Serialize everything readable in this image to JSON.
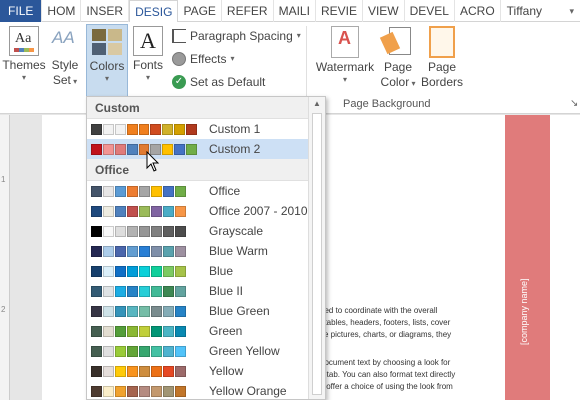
{
  "tabs": [
    {
      "label": "FILE",
      "active": false
    },
    {
      "label": "HOM",
      "active": false
    },
    {
      "label": "INSER",
      "active": false
    },
    {
      "label": "DESIG",
      "active": true
    },
    {
      "label": "PAGE",
      "active": false
    },
    {
      "label": "REFER",
      "active": false
    },
    {
      "label": "MAILI",
      "active": false
    },
    {
      "label": "REVIE",
      "active": false
    },
    {
      "label": "VIEW",
      "active": false
    },
    {
      "label": "DEVEL",
      "active": false
    },
    {
      "label": "ACRO",
      "active": false
    }
  ],
  "user_name": "Tiffany Gr...",
  "ribbon": {
    "themes": {
      "label": "Themes",
      "icon": "themes-icon"
    },
    "style_set": {
      "label1": "Style",
      "label2": "Set"
    },
    "colors": {
      "label": "Colors"
    },
    "fonts": {
      "label": "Fonts",
      "icon_glyph": "A"
    },
    "paragraph_spacing": "Paragraph Spacing",
    "effects": "Effects",
    "set_as_default": "Set as Default",
    "watermark": "Watermark",
    "page_color": {
      "label1": "Page",
      "label2": "Color"
    },
    "page_borders": {
      "label1": "Page",
      "label2": "Borders"
    },
    "group_page_background": "Page Background"
  },
  "dropdown": {
    "custom_header": "Custom",
    "office_header": "Office",
    "custom_items": [
      {
        "name": "Custom 1",
        "colors": [
          "#404040",
          "#f2f2f2",
          "#f2f2f2",
          "#f07f1e",
          "#f07f1e",
          "#d04c1f",
          "#d0b12a",
          "#d4a000",
          "#b03a1e"
        ],
        "hover": false
      },
      {
        "name": "Custom 2",
        "colors": [
          "#c0121c",
          "#f29494",
          "#e07b7b",
          "#4f81bd",
          "#e07b33",
          "#a5a5a5",
          "#ffc000",
          "#4472c4",
          "#70ad47"
        ],
        "hover": true
      }
    ],
    "office_items": [
      {
        "name": "Office",
        "colors": [
          "#44546a",
          "#e7e6e6",
          "#5b9bd5",
          "#ed7d31",
          "#a5a5a5",
          "#ffc000",
          "#4472c4",
          "#70ad47"
        ]
      },
      {
        "name": "Office 2007 - 2010",
        "colors": [
          "#1f497d",
          "#eeece1",
          "#4f81bd",
          "#c0504d",
          "#9bbb59",
          "#8064a2",
          "#4bacc6",
          "#f79646"
        ]
      },
      {
        "name": "Grayscale",
        "colors": [
          "#000000",
          "#f8f8f8",
          "#dddddd",
          "#b2b2b2",
          "#969696",
          "#808080",
          "#5f5f5f",
          "#4d4d4d"
        ]
      },
      {
        "name": "Blue Warm",
        "colors": [
          "#242852",
          "#acccea",
          "#4a66ac",
          "#629dd1",
          "#297fd5",
          "#7f8fa9",
          "#5aa2ae",
          "#9d90a0"
        ]
      },
      {
        "name": "Blue",
        "colors": [
          "#17406d",
          "#dbeff9",
          "#0f6fc6",
          "#009dd9",
          "#0bd0d9",
          "#10cf9b",
          "#7cca62",
          "#a5c249"
        ]
      },
      {
        "name": "Blue II",
        "colors": [
          "#335b74",
          "#dfe3e5",
          "#1cade4",
          "#2683c6",
          "#27ced7",
          "#42ba97",
          "#3e8853",
          "#62a39f"
        ]
      },
      {
        "name": "Blue Green",
        "colors": [
          "#373545",
          "#cee2e8",
          "#3494ba",
          "#58b6c0",
          "#75bda7",
          "#7a8c8e",
          "#84acb6",
          "#2683c6"
        ]
      },
      {
        "name": "Green",
        "colors": [
          "#455f51",
          "#e3ded1",
          "#549e39",
          "#8ab833",
          "#c0cf3a",
          "#029676",
          "#4ab5c4",
          "#0989b1"
        ]
      },
      {
        "name": "Green Yellow",
        "colors": [
          "#455f51",
          "#e0e0e0",
          "#99cb38",
          "#63a537",
          "#37a76f",
          "#44c1a3",
          "#4eb3cf",
          "#51c3f9"
        ]
      },
      {
        "name": "Yellow",
        "colors": [
          "#39302a",
          "#e5dedb",
          "#ffca08",
          "#f8931d",
          "#ce8d3e",
          "#ec7016",
          "#e64823",
          "#9c6a6a"
        ]
      },
      {
        "name": "Yellow Orange",
        "colors": [
          "#4e3b30",
          "#fbeec9",
          "#f0a22e",
          "#a5644e",
          "#b58b80",
          "#c3986d",
          "#a19574",
          "#c17529"
        ]
      }
    ]
  },
  "document": {
    "sidebar_text": "[company name]",
    "lines": [
      "ned to coordinate with the overall",
      "t tables, headers, footers, lists, cover",
      "ite pictures, charts, or diagrams, they",
      "",
      "document text by choosing a look for",
      "e tab. You can also format text directly",
      "s offer a choice of using the look from"
    ]
  },
  "ruler_ticks": [
    "1",
    "2"
  ],
  "colors": {
    "accent": "#2b579a",
    "hover": "#cde0f5",
    "sidebar": "#e07b7b"
  }
}
